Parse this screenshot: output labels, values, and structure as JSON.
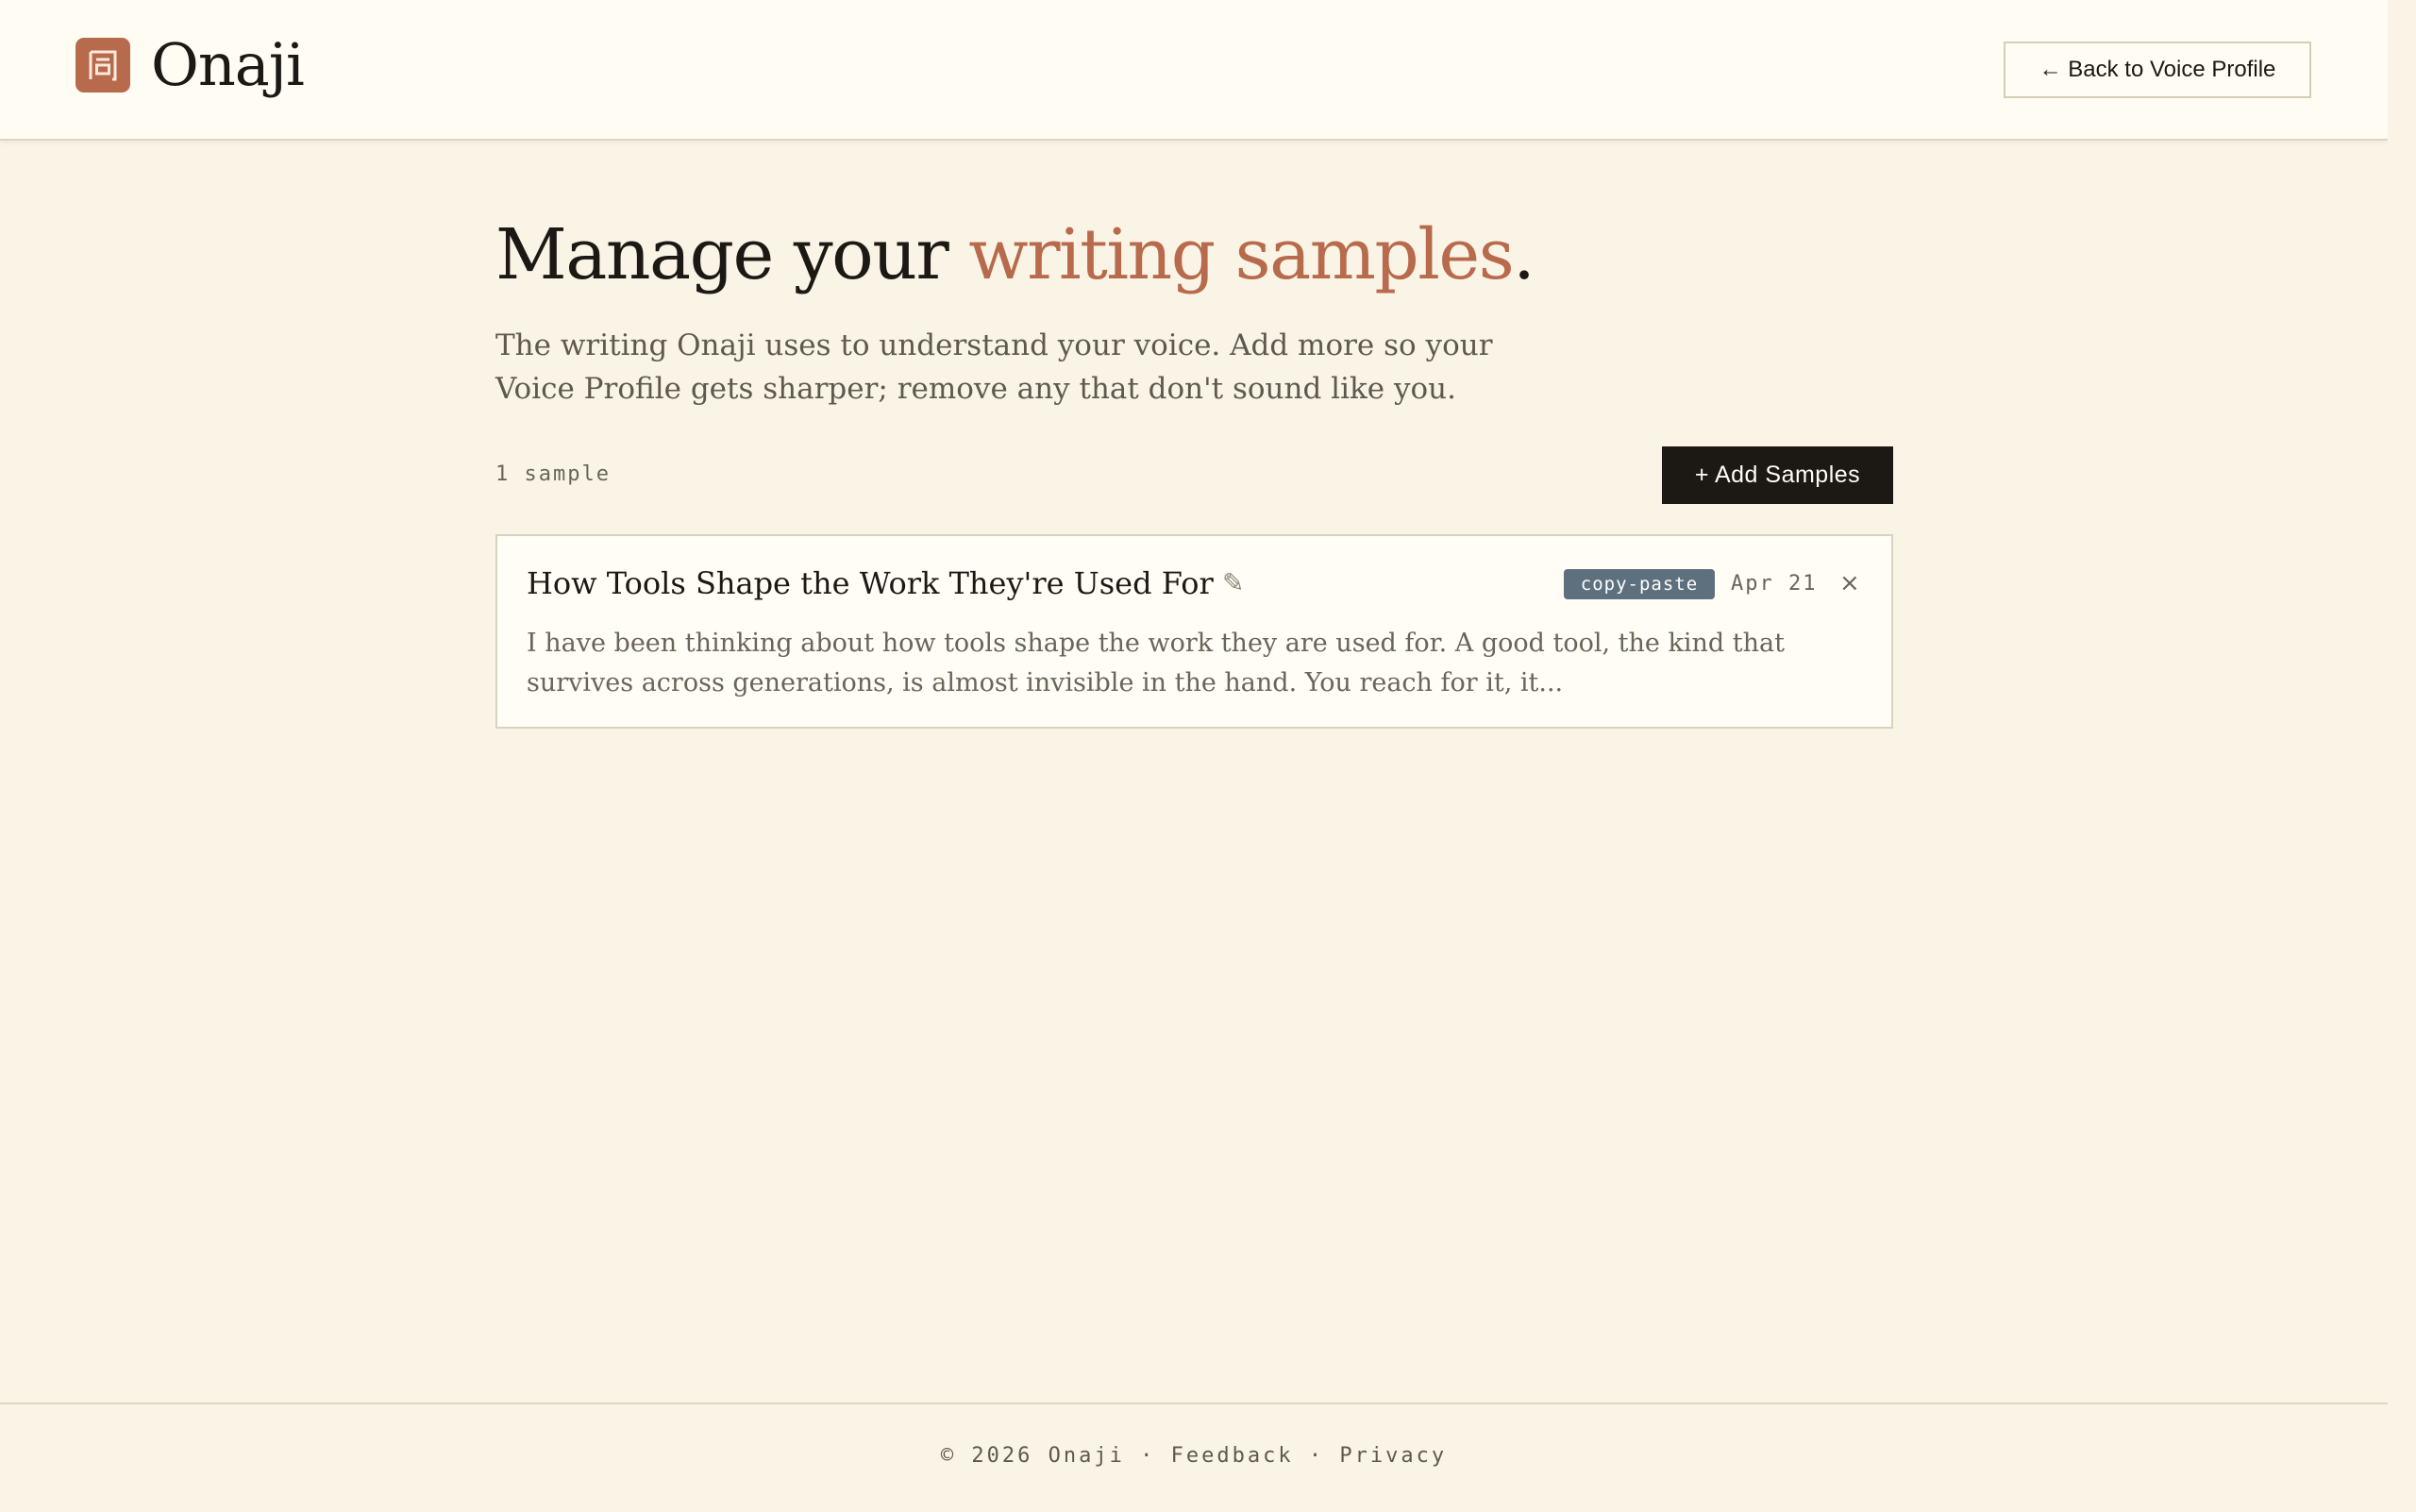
{
  "app": {
    "name": "Onaji",
    "logo_glyph": "同"
  },
  "header": {
    "back_label": "← Back to Voice Profile"
  },
  "page": {
    "title_prefix": "Manage your ",
    "title_accent": "writing samples",
    "title_suffix": ".",
    "description": "The writing Onaji uses to understand your voice. Add more so your Voice Profile gets sharper; remove any that don't sound like you."
  },
  "toolbar": {
    "sample_count": "1 sample",
    "add_label": "+ Add Samples"
  },
  "samples": [
    {
      "title": "How Tools Shape the Work They're Used For",
      "source": "copy-paste",
      "date": "Apr 21",
      "excerpt": "I have been thinking about how tools shape the work they are used for. A good tool, the kind that survives across generations, is almost invisible in the hand. You reach for it, it..."
    }
  ],
  "icons": {
    "edit": "✎",
    "delete": "×",
    "back_arrow": "←"
  },
  "footer": {
    "copyright": "© 2026 Onaji",
    "separator": "·",
    "feedback": "Feedback",
    "privacy": "Privacy"
  },
  "colors": {
    "background": "#faf4e6",
    "header": "#fffcf3",
    "accent": "#b86a4c",
    "text": "#1c1915",
    "muted": "#5f584e",
    "badge": "#5e6f7d",
    "primary_button": "#1c1915"
  }
}
